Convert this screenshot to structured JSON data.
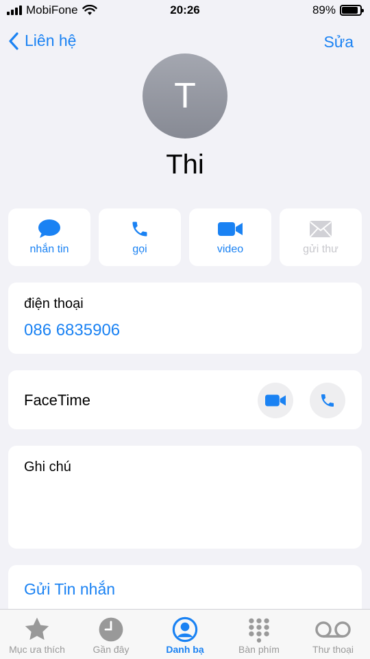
{
  "status_bar": {
    "carrier": "MobiFone",
    "time": "20:26",
    "battery": "89%",
    "battery_level": 0.89
  },
  "nav": {
    "back_label": "Liên hệ",
    "edit_label": "Sửa"
  },
  "contact": {
    "initial": "T",
    "name": "Thi"
  },
  "actions": [
    {
      "label": "nhắn tin",
      "icon": "message-icon",
      "enabled": true
    },
    {
      "label": "gọi",
      "icon": "phone-icon",
      "enabled": true
    },
    {
      "label": "video",
      "icon": "video-icon",
      "enabled": true
    },
    {
      "label": "gửi thư",
      "icon": "mail-icon",
      "enabled": false
    }
  ],
  "phone": {
    "label": "điện thoại",
    "number": "086 6835906"
  },
  "facetime": {
    "label": "FaceTime"
  },
  "notes": {
    "label": "Ghi chú"
  },
  "send_message": {
    "label": "Gửi Tin nhắn"
  },
  "tabs": [
    {
      "label": "Mục ưa thích",
      "icon": "star-icon"
    },
    {
      "label": "Gần đây",
      "icon": "clock-icon"
    },
    {
      "label": "Danh bạ",
      "icon": "contacts-icon",
      "active": true
    },
    {
      "label": "Bàn phím",
      "icon": "keypad-icon"
    },
    {
      "label": "Thư thoại",
      "icon": "voicemail-icon"
    }
  ],
  "colors": {
    "accent": "#1a82f3",
    "background": "#f2f2f7",
    "card": "#ffffff",
    "disabled": "#c7c7cc"
  }
}
